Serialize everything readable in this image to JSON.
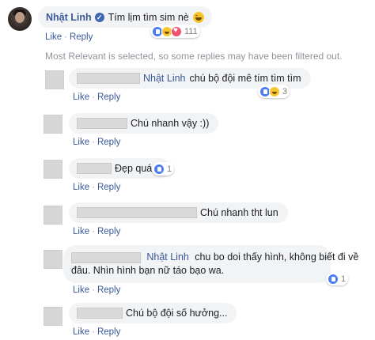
{
  "top_comment": {
    "author": "Nhật Linh",
    "text": "Tím lịm tìm sim nè",
    "actions": {
      "like": "Like",
      "reply": "Reply"
    },
    "reaction_count": "111"
  },
  "notice": "Most Relevant is selected, so some replies may have been filtered out.",
  "replies": [
    {
      "mention": "Nhật Linh",
      "text": "chú bộ đội mê tím tìm tìm",
      "like": "Like",
      "reply": "Reply",
      "reaction_count": "3"
    },
    {
      "mention": "",
      "text": "Chú nhanh vậy :))",
      "like": "Like",
      "reply": "Reply",
      "reaction_count": ""
    },
    {
      "mention": "",
      "text": "Đẹp quá a",
      "like": "Like",
      "reply": "Reply",
      "reaction_count": "1"
    },
    {
      "mention": "",
      "text": "Chú nhanh tht lun",
      "like": "Like",
      "reply": "Reply",
      "reaction_count": ""
    },
    {
      "mention": "Nhật Linh",
      "text_line1": "chu bo doi thấy hình, không biết đi về",
      "text_line2": "đâu. Nhìn hình bạn nữ táo bạo wa.",
      "like": "Like",
      "reply": "Reply",
      "reaction_count": "1"
    },
    {
      "mention": "",
      "text": "Chú bộ đội số hưởng...",
      "like": "Like",
      "reply": "Reply",
      "reaction_count": ""
    }
  ]
}
